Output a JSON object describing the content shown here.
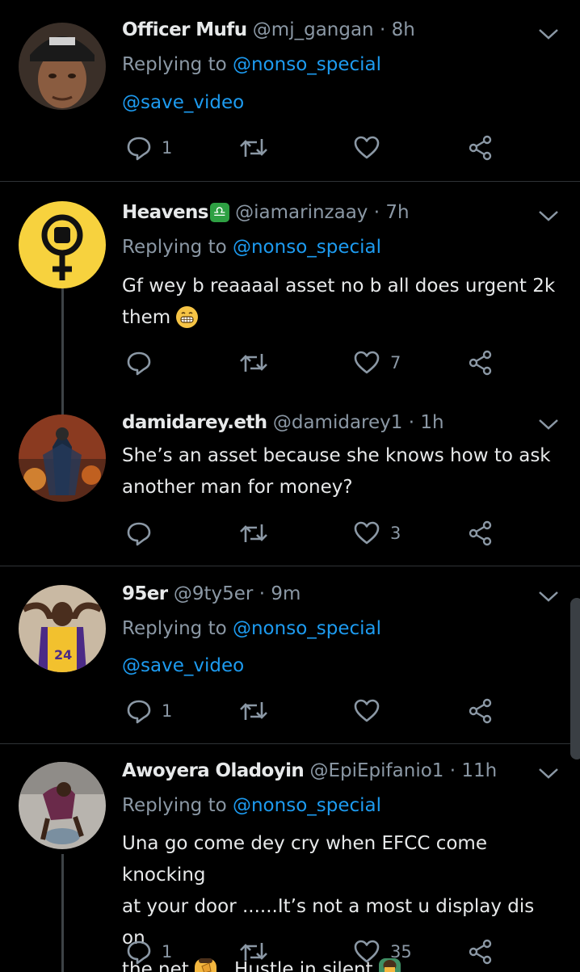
{
  "tweets": [
    {
      "name": "Officer Mufu",
      "handle": "@mj_gangan",
      "time": "· 8h",
      "reply_label": "Replying to",
      "reply_handle": "@nonso_special",
      "text_link": "@save_video",
      "reply_count": "1",
      "retweet_count": "",
      "like_count": ""
    },
    {
      "name": "Heavens",
      "name_badge": "♎",
      "handle": "@iamarinzaay",
      "time": "· 7h",
      "reply_label": "Replying to",
      "reply_handle": "@nonso_special",
      "text_line1": "Gf wey b reaaaal asset no b all does urgent 2k",
      "text_line2": "them",
      "text_emoji": "grinning-face-emoji",
      "reply_count": "",
      "retweet_count": "",
      "like_count": "7"
    },
    {
      "name": "damidarey.eth",
      "handle": "@damidarey1",
      "time": "· 1h",
      "text_line1": "She’s an asset because she knows how to ask",
      "text_line2": "another man for money?",
      "reply_count": "",
      "retweet_count": "",
      "like_count": "3"
    },
    {
      "name": "95er",
      "handle": "@9ty5er",
      "time": "· 9m",
      "reply_label": "Replying to",
      "reply_handle": "@nonso_special",
      "text_link": "@save_video",
      "reply_count": "1",
      "retweet_count": "",
      "like_count": ""
    },
    {
      "name": "Awoyera Oladoyin",
      "handle": "@EpiEpifanio1",
      "time": "· 11h",
      "reply_label": "Replying to",
      "reply_handle": "@nonso_special",
      "text_line1": "Una go come dey cry when EFCC come knocking",
      "text_line2": "at your door ......It’s not a most u display dis on",
      "text_line3a": "the net",
      "text_line3b": ". Hustle in silent",
      "reply_count": "1",
      "retweet_count": "",
      "like_count": "35"
    }
  ],
  "colors": {
    "background": "#000000",
    "link": "#1d9bf0",
    "secondary_text": "#8b98a5",
    "separator": "#2f3336"
  }
}
